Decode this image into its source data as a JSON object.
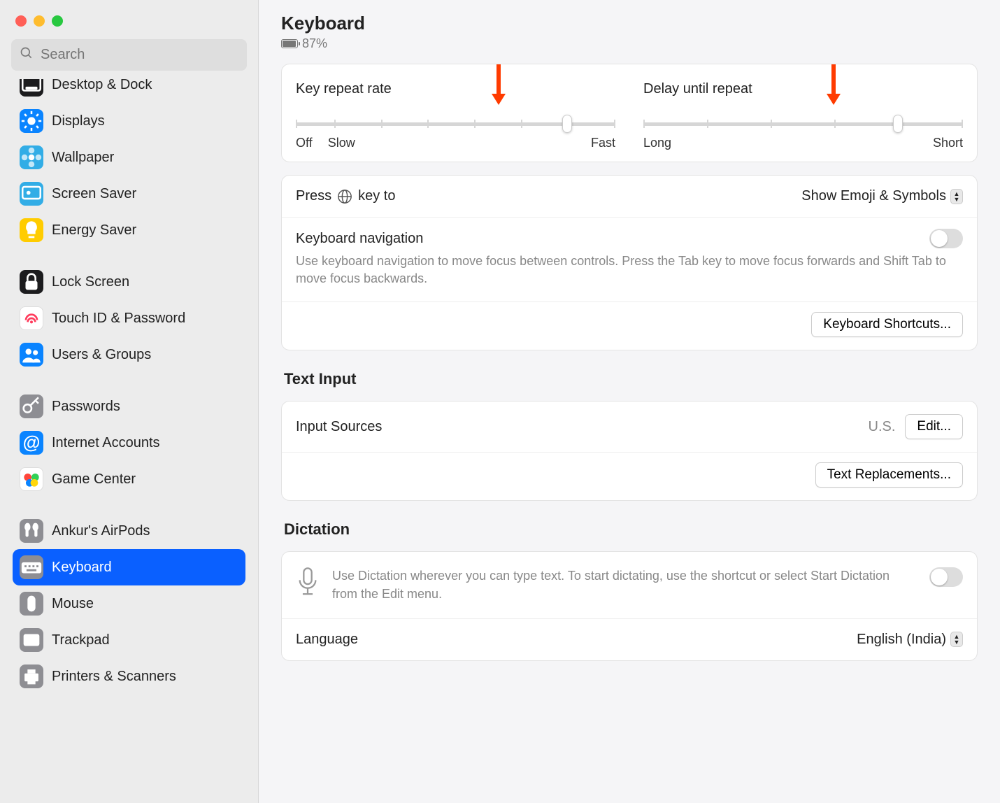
{
  "header": {
    "title": "Keyboard",
    "battery": "87%"
  },
  "search": {
    "placeholder": "Search"
  },
  "sidebar": [
    {
      "label": "Desktop & Dock",
      "bg": "#1c1c1e",
      "icon": "dock"
    },
    {
      "label": "Displays",
      "bg": "#0a84ff",
      "icon": "sun"
    },
    {
      "label": "Wallpaper",
      "bg": "#32ade6",
      "icon": "flower"
    },
    {
      "label": "Screen Saver",
      "bg": "#32ade6",
      "icon": "screensaver"
    },
    {
      "label": "Energy Saver",
      "bg": "#ffcc00",
      "icon": "bulb"
    },
    {
      "gap": true
    },
    {
      "label": "Lock Screen",
      "bg": "#1c1c1e",
      "icon": "lock"
    },
    {
      "label": "Touch ID & Password",
      "bg": "#fff",
      "icon": "touchid"
    },
    {
      "label": "Users & Groups",
      "bg": "#0a84ff",
      "icon": "users"
    },
    {
      "gap": true
    },
    {
      "label": "Passwords",
      "bg": "#8e8e93",
      "icon": "key"
    },
    {
      "label": "Internet Accounts",
      "bg": "#0a84ff",
      "icon": "at"
    },
    {
      "label": "Game Center",
      "bg": "#fff",
      "icon": "gamecenter"
    },
    {
      "gap": true
    },
    {
      "label": "Ankur's AirPods",
      "bg": "#8e8e93",
      "icon": "airpods"
    },
    {
      "label": "Keyboard",
      "bg": "#8e8e93",
      "icon": "keyboard",
      "selected": true
    },
    {
      "label": "Mouse",
      "bg": "#8e8e93",
      "icon": "mouse"
    },
    {
      "label": "Trackpad",
      "bg": "#8e8e93",
      "icon": "trackpad"
    },
    {
      "label": "Printers & Scanners",
      "bg": "#8e8e93",
      "icon": "printer"
    }
  ],
  "sliders": {
    "keyrepeat": {
      "title": "Key repeat rate",
      "left1": "Off",
      "left2": "Slow",
      "right": "Fast"
    },
    "delay": {
      "title": "Delay until repeat",
      "left": "Long",
      "right": "Short"
    }
  },
  "globe": {
    "label_pre": "Press",
    "label_post": "key to",
    "value": "Show Emoji & Symbols"
  },
  "nav": {
    "title": "Keyboard navigation",
    "desc": "Use keyboard navigation to move focus between controls. Press the Tab key to move focus forwards and Shift Tab to move focus backwards."
  },
  "shortcuts_btn": "Keyboard Shortcuts...",
  "text_input": {
    "title": "Text Input",
    "sources_label": "Input Sources",
    "sources_value": "U.S.",
    "edit_btn": "Edit...",
    "replacements_btn": "Text Replacements..."
  },
  "dictation": {
    "title": "Dictation",
    "desc": "Use Dictation wherever you can type text. To start dictating, use the shortcut or select Start Dictation from the Edit menu.",
    "lang_label": "Language",
    "lang_value": "English (India)"
  }
}
